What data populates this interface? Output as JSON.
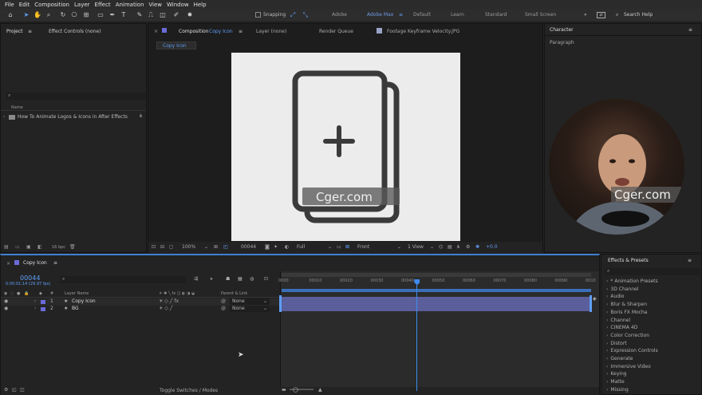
{
  "menu": [
    "File",
    "Edit",
    "Composition",
    "Layer",
    "Effect",
    "Animation",
    "View",
    "Window",
    "Help"
  ],
  "toolbar": {
    "snapping": "Snapping",
    "workspaces": [
      "Adobe",
      "Adobe Max",
      "Default",
      "Learn",
      "Standard",
      "Small Screen"
    ],
    "search": "Search Help"
  },
  "project": {
    "tab": "Project",
    "tab2": "Effect Controls (none)",
    "col_name": "Name",
    "item": "How To Animate Logos & Icons in After Effects",
    "bpc": "16 bpc"
  },
  "viewer": {
    "tab_comp_prefix": "Composition",
    "tab_comp_name": "Copy Icon",
    "tab_layer": "Layer (none)",
    "tab_render": "Render Queue",
    "tab_footage": "Footage Keyframe Velocity.JPG",
    "subtab": "Copy Icon",
    "zoom": "100%",
    "timecode": "00044",
    "resolution": "Full",
    "view": "Front",
    "views": "1 View",
    "exposure": "+0.0"
  },
  "character": {
    "title": "Character",
    "paragraph": "Paragraph"
  },
  "watermark": "Cger.com",
  "timeline": {
    "tab": "Copy Icon",
    "timecode": "00044",
    "fps": "0:00:01:14 (29.97 fps)",
    "col_num": "#",
    "col_layer": "Layer Name",
    "col_parent": "Parent & Link",
    "layers": [
      {
        "num": "1",
        "name": "Copy Icon",
        "parent": "None",
        "color": "#6a6ad8"
      },
      {
        "num": "2",
        "name": "BG",
        "parent": "None",
        "color": "#6a6ad8"
      }
    ],
    "ruler": [
      "0000",
      "00010",
      "00020",
      "00030",
      "00040",
      "00050",
      "00060",
      "00070",
      "00080",
      "00090",
      "0010"
    ],
    "toggle": "Toggle Switches / Modes",
    "playhead": 0.44
  },
  "effects": {
    "title": "Effects & Presets",
    "items": [
      "* Animation Presets",
      "3D Channel",
      "Audio",
      "Blur & Sharpen",
      "Boris FX Mocha",
      "Channel",
      "CINEMA 4D",
      "Color Correction",
      "Distort",
      "Expression Controls",
      "Generate",
      "Immersive Video",
      "Keying",
      "Matte",
      "Missing"
    ]
  }
}
